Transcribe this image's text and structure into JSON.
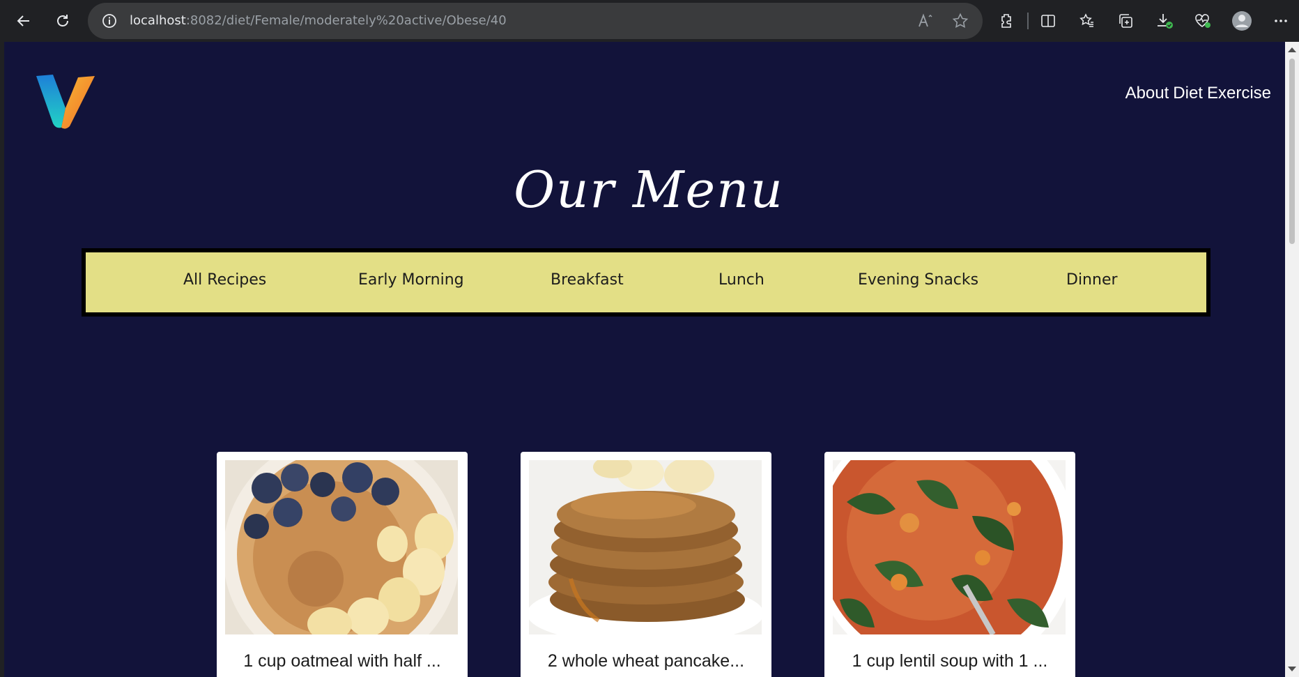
{
  "browser": {
    "url_host": "localhost",
    "url_path": ":8082/diet/Female/moderately%20active/Obese/40",
    "icons": [
      "back-icon",
      "refresh-icon",
      "info-icon",
      "read-aloud-icon",
      "favorite-star-icon",
      "extensions-icon",
      "split-screen-icon",
      "favorites-icon",
      "collections-icon",
      "downloads-icon",
      "performance-icon",
      "profile-icon",
      "more-icon"
    ]
  },
  "header": {
    "nav_links": [
      "About",
      "Diet",
      "Exercise"
    ]
  },
  "menu": {
    "title": "Our Menu",
    "categories": [
      "All Recipes",
      "Early Morning",
      "Breakfast",
      "Lunch",
      "Evening Snacks",
      "Dinner"
    ]
  },
  "recipes": [
    {
      "title": "1 cup oatmeal with half ..."
    },
    {
      "title": "2 whole wheat pancake..."
    },
    {
      "title": "1 cup lentil soup with 1 ..."
    }
  ],
  "colors": {
    "page_background": "#12133a",
    "category_bar": "#e3df86",
    "card_background": "#ffffff"
  }
}
